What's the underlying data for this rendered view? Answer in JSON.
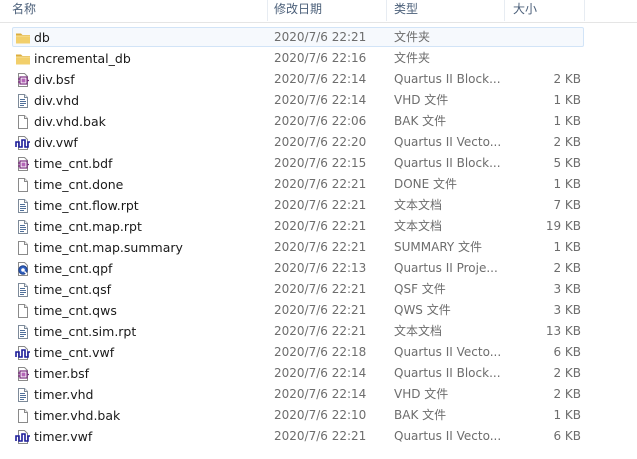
{
  "columns": {
    "name": "名称",
    "date": "修改日期",
    "type": "类型",
    "size": "大小"
  },
  "files": [
    {
      "name": "db",
      "date": "2020/7/6 22:21",
      "type": "文件夹",
      "size": "",
      "icon": "folder-icon",
      "selected": true
    },
    {
      "name": "incremental_db",
      "date": "2020/7/6 22:16",
      "type": "文件夹",
      "size": "",
      "icon": "folder-icon"
    },
    {
      "name": "div.bsf",
      "date": "2020/7/6 22:14",
      "type": "Quartus II Block...",
      "size": "2 KB",
      "icon": "quartus-block-icon"
    },
    {
      "name": "div.vhd",
      "date": "2020/7/6 22:14",
      "type": "VHD 文件",
      "size": "1 KB",
      "icon": "text-file-icon"
    },
    {
      "name": "div.vhd.bak",
      "date": "2020/7/6 22:06",
      "type": "BAK 文件",
      "size": "1 KB",
      "icon": "blank-file-icon"
    },
    {
      "name": "div.vwf",
      "date": "2020/7/6 22:20",
      "type": "Quartus II Vecto...",
      "size": "2 KB",
      "icon": "waveform-icon"
    },
    {
      "name": "time_cnt.bdf",
      "date": "2020/7/6 22:15",
      "type": "Quartus II Block...",
      "size": "5 KB",
      "icon": "quartus-block-icon"
    },
    {
      "name": "time_cnt.done",
      "date": "2020/7/6 22:21",
      "type": "DONE 文件",
      "size": "1 KB",
      "icon": "blank-file-icon"
    },
    {
      "name": "time_cnt.flow.rpt",
      "date": "2020/7/6 22:21",
      "type": "文本文档",
      "size": "7 KB",
      "icon": "text-file-icon"
    },
    {
      "name": "time_cnt.map.rpt",
      "date": "2020/7/6 22:21",
      "type": "文本文档",
      "size": "19 KB",
      "icon": "text-file-icon"
    },
    {
      "name": "time_cnt.map.summary",
      "date": "2020/7/6 22:21",
      "type": "SUMMARY 文件",
      "size": "1 KB",
      "icon": "blank-file-icon"
    },
    {
      "name": "time_cnt.qpf",
      "date": "2020/7/6 22:13",
      "type": "Quartus II Proje...",
      "size": "2 KB",
      "icon": "quartus-project-icon"
    },
    {
      "name": "time_cnt.qsf",
      "date": "2020/7/6 22:21",
      "type": "QSF 文件",
      "size": "3 KB",
      "icon": "text-file-icon"
    },
    {
      "name": "time_cnt.qws",
      "date": "2020/7/6 22:21",
      "type": "QWS 文件",
      "size": "3 KB",
      "icon": "blank-file-icon"
    },
    {
      "name": "time_cnt.sim.rpt",
      "date": "2020/7/6 22:21",
      "type": "文本文档",
      "size": "13 KB",
      "icon": "text-file-icon"
    },
    {
      "name": "time_cnt.vwf",
      "date": "2020/7/6 22:18",
      "type": "Quartus II Vecto...",
      "size": "6 KB",
      "icon": "waveform-icon"
    },
    {
      "name": "timer.bsf",
      "date": "2020/7/6 22:14",
      "type": "Quartus II Block...",
      "size": "2 KB",
      "icon": "quartus-block-icon"
    },
    {
      "name": "timer.vhd",
      "date": "2020/7/6 22:14",
      "type": "VHD 文件",
      "size": "2 KB",
      "icon": "text-file-icon"
    },
    {
      "name": "timer.vhd.bak",
      "date": "2020/7/6 22:10",
      "type": "BAK 文件",
      "size": "1 KB",
      "icon": "blank-file-icon"
    },
    {
      "name": "timer.vwf",
      "date": "2020/7/6 22:21",
      "type": "Quartus II Vecto...",
      "size": "6 KB",
      "icon": "waveform-icon"
    }
  ],
  "colors": {
    "selection_border": "#d2e4f7",
    "selection_fill": "#f6f9fd",
    "header_text": "#4c607a",
    "folder": "#e8c15c",
    "quartus_purple": "#7a2b7e",
    "waveform_blue": "#1c1c9a"
  }
}
